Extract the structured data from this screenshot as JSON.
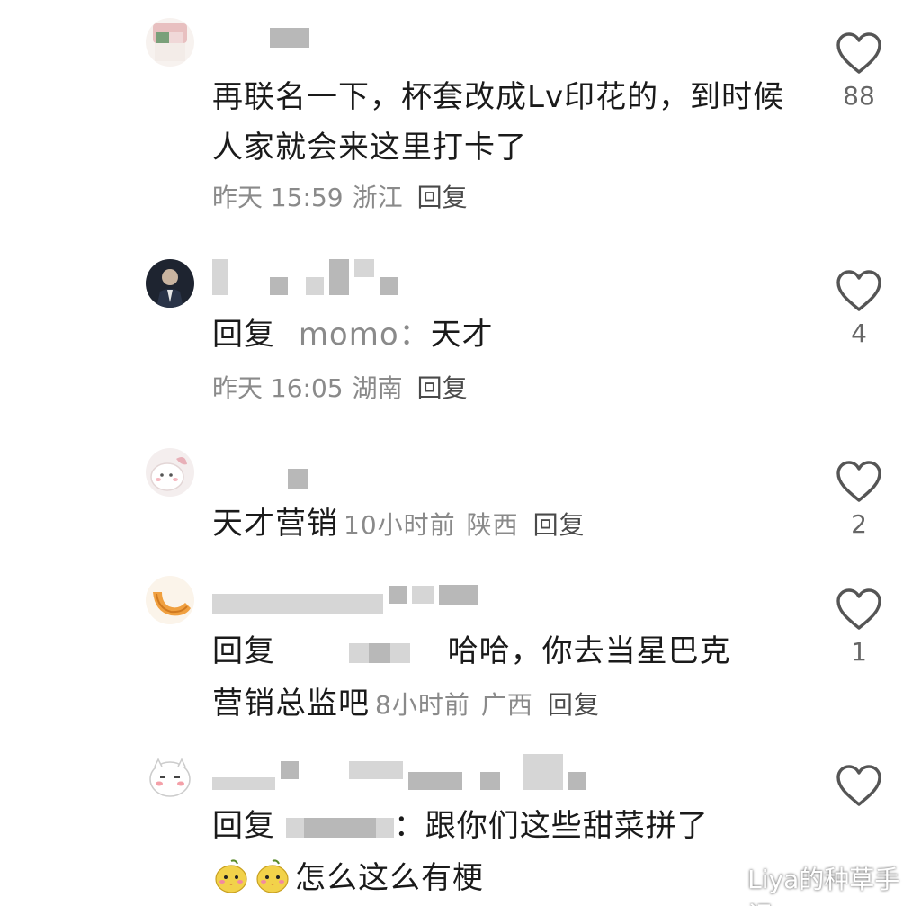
{
  "comments": [
    {
      "text": "再联名一下，杯套改成Lv印花的，到时候人家就会来这里打卡了",
      "time": "昨天 15:59",
      "location": "浙江",
      "reply_label": "回复",
      "likes": "88"
    },
    {
      "reply_kw": "回复",
      "reply_target": "momo：",
      "text": "天才",
      "time": "昨天 16:05",
      "location": "湖南",
      "reply_label": "回复",
      "likes": "4"
    },
    {
      "text": "天才营销",
      "time": "10小时前",
      "location": "陕西",
      "reply_label": "回复",
      "likes": "2"
    },
    {
      "reply_kw": "回复",
      "text_line1": "哈哈，你去当星巴克",
      "text_line2": "营销总监吧",
      "time": "8小时前",
      "location": "广西",
      "reply_label": "回复",
      "likes": "1"
    },
    {
      "reply_kw": "回复",
      "text_line1": "：跟你们这些甜菜拼了",
      "text_line2": "怎么这么有梗"
    }
  ],
  "watermark": "Liya的种草手记",
  "colors": {
    "text": "#1a1a1a",
    "meta": "#8a8a8a",
    "heart": "#555555"
  }
}
